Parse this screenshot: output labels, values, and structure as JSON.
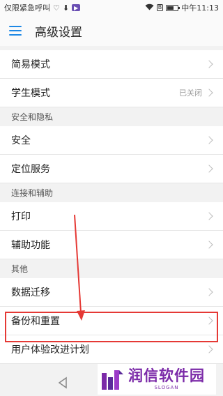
{
  "status_bar": {
    "carrier_text": "仅限紧急呼叫",
    "time": "中午11:13",
    "sim_badge": "B"
  },
  "app_bar": {
    "title": "高级设置"
  },
  "list": {
    "group1": [
      {
        "label": "简易模式",
        "value": ""
      },
      {
        "label": "学生模式",
        "value": "已关闭"
      }
    ],
    "section_security": "安全和隐私",
    "group2": [
      {
        "label": "安全"
      },
      {
        "label": "定位服务"
      }
    ],
    "section_accessibility": "连接和辅助",
    "group3": [
      {
        "label": "打印"
      },
      {
        "label": "辅助功能"
      }
    ],
    "section_other": "其他",
    "group4": [
      {
        "label": "数据迁移"
      },
      {
        "label": "备份和重置"
      },
      {
        "label": "用户体验改进计划"
      }
    ]
  },
  "watermark": {
    "title": "润信软件园",
    "slogan": "SLOGAN"
  },
  "colors": {
    "accent": "#1e88e5",
    "highlight": "#e53935",
    "watermark": "#7b2aa8"
  }
}
